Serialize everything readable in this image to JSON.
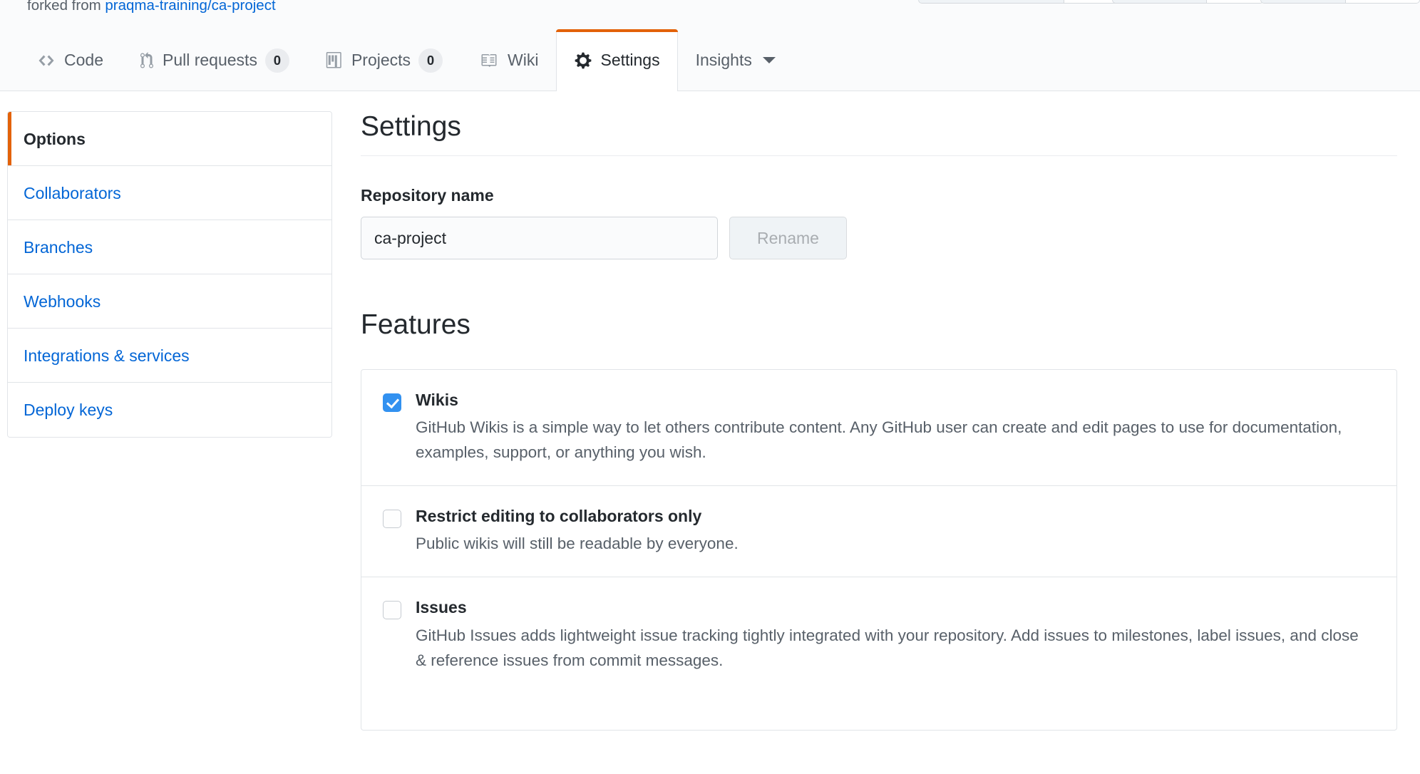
{
  "repo_header": {
    "fork_prefix": "forked from ",
    "fork_source": "praqma-training/ca-project"
  },
  "repo_nav": {
    "tabs": [
      {
        "icon": "code-icon",
        "label": "Code",
        "count": null,
        "selected": false,
        "dropdown": false
      },
      {
        "icon": "git-pull-request-icon",
        "label": "Pull requests",
        "count": "0",
        "selected": false,
        "dropdown": false
      },
      {
        "icon": "project-board-icon",
        "label": "Projects",
        "count": "0",
        "selected": false,
        "dropdown": false
      },
      {
        "icon": "book-icon",
        "label": "Wiki",
        "count": null,
        "selected": false,
        "dropdown": false
      },
      {
        "icon": "gear-icon",
        "label": "Settings",
        "count": null,
        "selected": true,
        "dropdown": false
      },
      {
        "icon": null,
        "label": "Insights",
        "count": null,
        "selected": false,
        "dropdown": true
      }
    ]
  },
  "sidebar": {
    "items": [
      {
        "label": "Options",
        "selected": true
      },
      {
        "label": "Collaborators",
        "selected": false
      },
      {
        "label": "Branches",
        "selected": false
      },
      {
        "label": "Webhooks",
        "selected": false
      },
      {
        "label": "Integrations & services",
        "selected": false
      },
      {
        "label": "Deploy keys",
        "selected": false
      }
    ]
  },
  "main": {
    "settings_heading": "Settings",
    "repository_name_label": "Repository name",
    "repository_name_value": "ca-project",
    "repository_name_placeholder": "Repository name",
    "rename_button_label": "Rename",
    "features_heading": "Features",
    "features": [
      {
        "title": "Wikis",
        "description": "GitHub Wikis is a simple way to let others contribute content. Any GitHub user can create and edit pages to use for documentation, examples, support, or anything you wish.",
        "checked": true
      },
      {
        "title": "Restrict editing to collaborators only",
        "description": "Public wikis will still be readable by everyone.",
        "checked": false
      },
      {
        "title": "Issues",
        "description": "GitHub Issues adds lightweight issue tracking tightly integrated with your repository. Add issues to milestones, label issues, and close & reference issues from commit messages.",
        "checked": false
      }
    ]
  },
  "colors": {
    "accent_orange": "#e36209",
    "link_blue": "#0366d6",
    "checkbox_blue": "#3291f0",
    "border_gray": "#e1e4e8",
    "text_dark": "#24292e",
    "text_muted": "#586069",
    "nav_bg": "#fafbfc"
  }
}
